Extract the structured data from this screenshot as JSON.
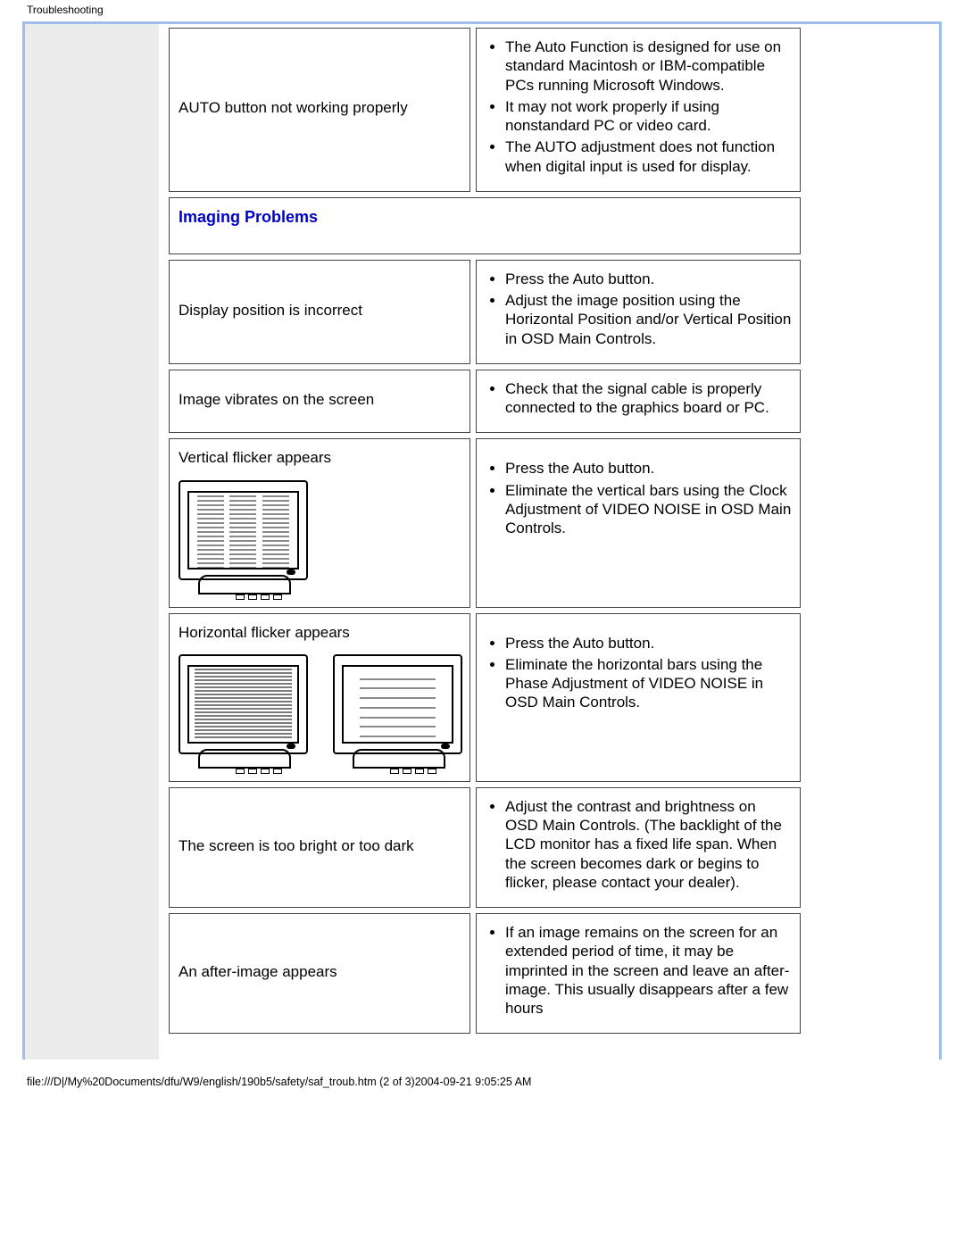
{
  "page_title": "Troubleshooting",
  "footer_line": "file:///D|/My%20Documents/dfu/W9/english/190b5/safety/saf_troub.htm (2 of 3)2004-09-21 9:05:25 AM",
  "rows": {
    "r0": {
      "problem": "AUTO button not working properly",
      "sol": [
        "The Auto Function is designed for use on standard Macintosh or IBM-compatible PCs running Microsoft Windows.",
        "It may not work properly if using nonstandard PC or video card.",
        "The AUTO adjustment does not function when digital input is used for display."
      ]
    },
    "section_header": "Imaging Problems",
    "r1": {
      "problem": "Display position is incorrect",
      "sol": [
        "Press the Auto button.",
        "Adjust the image position using the Horizontal Position and/or Vertical Position in OSD Main Controls."
      ]
    },
    "r2": {
      "problem": "Image vibrates on the screen",
      "sol": [
        "Check that the signal cable is properly connected to the graphics board or PC."
      ]
    },
    "r3": {
      "problem": "Vertical flicker appears",
      "sol": [
        "Press the Auto button.",
        "Eliminate the vertical bars using the Clock Adjustment of VIDEO NOISE in OSD Main Controls."
      ]
    },
    "r4": {
      "problem": "Horizontal flicker appears",
      "sol": [
        "Press the Auto button.",
        "Eliminate the horizontal bars using the Phase Adjustment of VIDEO NOISE in OSD Main Controls."
      ]
    },
    "r5": {
      "problem": "The screen is too bright or too dark",
      "sol": [
        "Adjust the contrast and brightness on OSD Main Controls. (The backlight of the LCD monitor has a fixed life span. When the screen becomes dark or begins to flicker, please contact your dealer)."
      ]
    },
    "r6": {
      "problem": "An after-image appears",
      "sol": [
        "If an image remains on the screen for an extended period of time, it may be imprinted in the screen and leave an after-image. This usually disappears after a few hours"
      ]
    }
  }
}
